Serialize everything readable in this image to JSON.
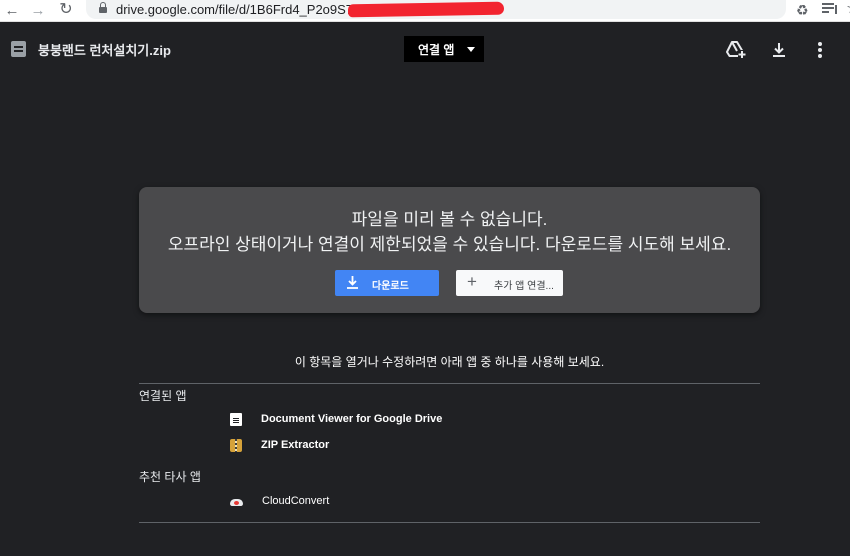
{
  "browser": {
    "url": "drive.google.com/file/d/1B6Frd4_P2o9S70",
    "back_icon": "arrow-left-icon",
    "forward_icon": "arrow-right-icon",
    "reload_icon": "reload-icon",
    "star_icon": "star-icon",
    "extensions_icon": "puzzle-icon",
    "media_icon": "media-control-icon"
  },
  "header": {
    "file_name": "붕붕랜드 런처설치기.zip",
    "open_with_label": "연결 앱",
    "icons": [
      "add-to-drive-icon",
      "download-icon",
      "more-vert-icon"
    ]
  },
  "preview": {
    "line1": "파일을 미리 볼 수 없습니다.",
    "line2": "오프라인 상태이거나 연결이 제한되었을 수 있습니다. 다운로드를 시도해 보세요.",
    "download_label": "다운로드",
    "add_app_label": "추가 앱 연결..."
  },
  "apps": {
    "hint": "이 항목을 열거나 수정하려면 아래 앱 중 하나를 사용해 보세요.",
    "connected_label": "연결된 앱",
    "connected": [
      {
        "name": "Document Viewer for Google Drive",
        "icon": "document-icon"
      },
      {
        "name": "ZIP Extractor",
        "icon": "zip-icon"
      }
    ],
    "recommended_label": "추천 타사 앱",
    "recommended": [
      {
        "name": "CloudConvert",
        "icon": "cloud-icon"
      }
    ]
  },
  "colors": {
    "background": "#202124",
    "card": "#4a4a4c",
    "primary_button": "#4285f4",
    "redaction": "#f2242f"
  }
}
